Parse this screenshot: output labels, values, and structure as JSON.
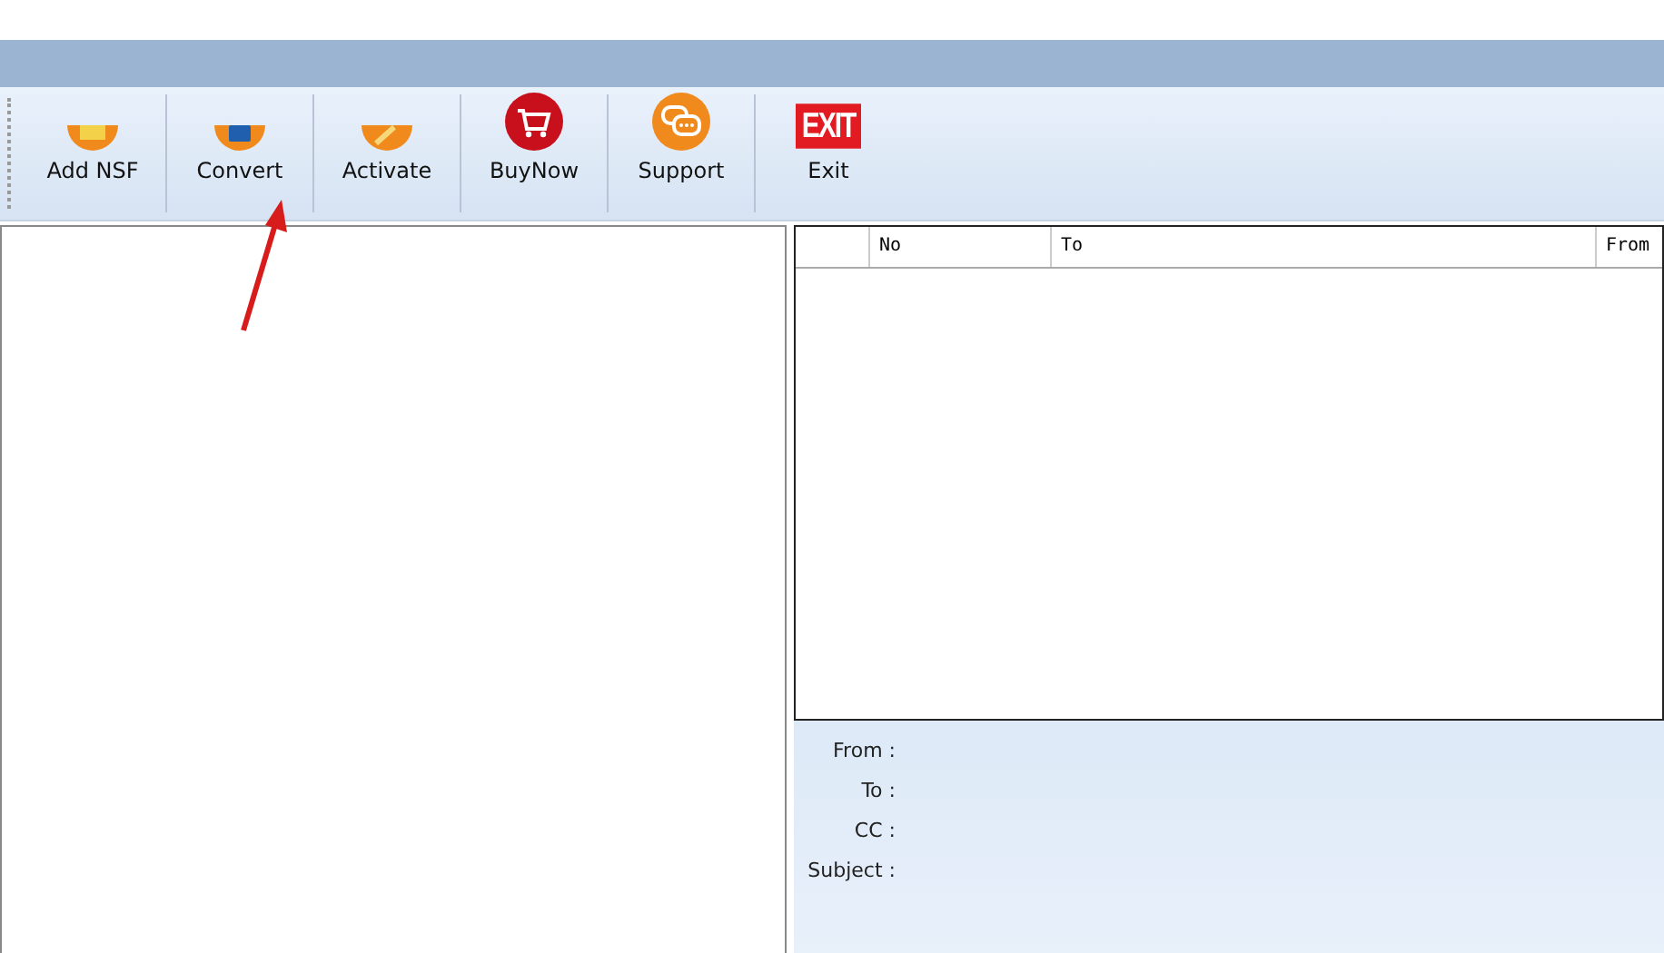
{
  "toolbar": [
    {
      "label": "Add NSF",
      "kind": "folder"
    },
    {
      "label": "Convert",
      "kind": "disk"
    },
    {
      "label": "Activate",
      "kind": "key"
    },
    {
      "label": "BuyNow",
      "kind": "cart"
    },
    {
      "label": "Support",
      "kind": "chat"
    },
    {
      "label": "Exit",
      "kind": "exit",
      "icon_text": "EXIT"
    }
  ],
  "table": {
    "columns": [
      "No",
      "To",
      "From"
    ]
  },
  "details": [
    "From :",
    "To :",
    "CC :",
    "Subject :"
  ]
}
